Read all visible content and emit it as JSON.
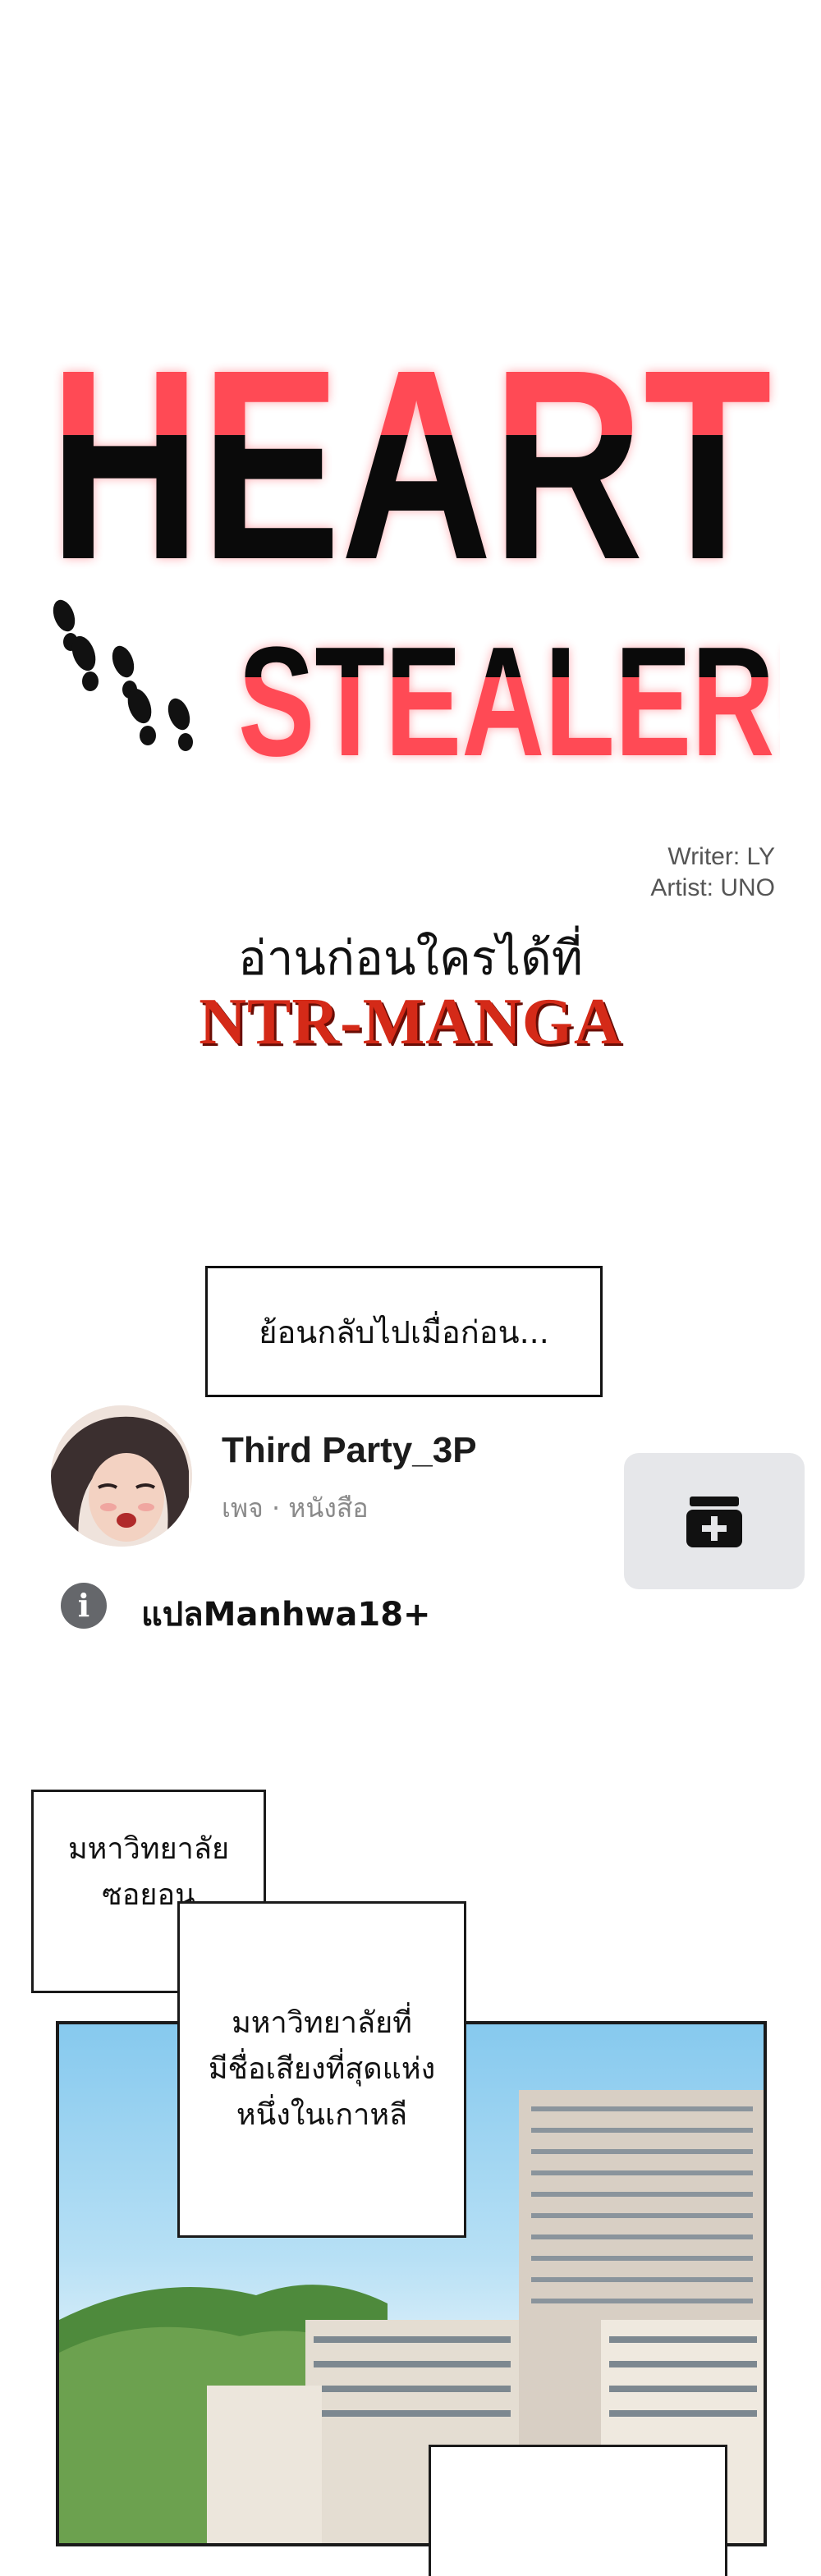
{
  "title": {
    "line1": "HEART",
    "line2": "STEALER!"
  },
  "credits": {
    "writer": "Writer: LY",
    "artist": "Artist: UNO"
  },
  "promo": {
    "read_first": "อ่านก่อนใครได้ที่",
    "site": "NTR-MANGA"
  },
  "caption_box": "ย้อนกลับไปเมื่อก่อน...",
  "page_card": {
    "name": "Third Party_3P",
    "meta": "เพจ · หนังสือ",
    "info_label": "แปลManhwa18+",
    "follow_icon": "add-bookmark-icon",
    "info_icon": "info-icon"
  },
  "panel": {
    "bubble1": [
      "มหาวิทยาลัย",
      "ซอยอน"
    ],
    "bubble2": [
      "มหาวิทยาลัยที่",
      "มีชื่อเสียงที่สุดแห่ง",
      "หนึ่งในเกาหลี"
    ]
  },
  "colors": {
    "title_red": "#ff4a55",
    "title_black": "#0a0a0a",
    "site_red": "#d42a18",
    "button_bg": "#e6e7ea"
  }
}
